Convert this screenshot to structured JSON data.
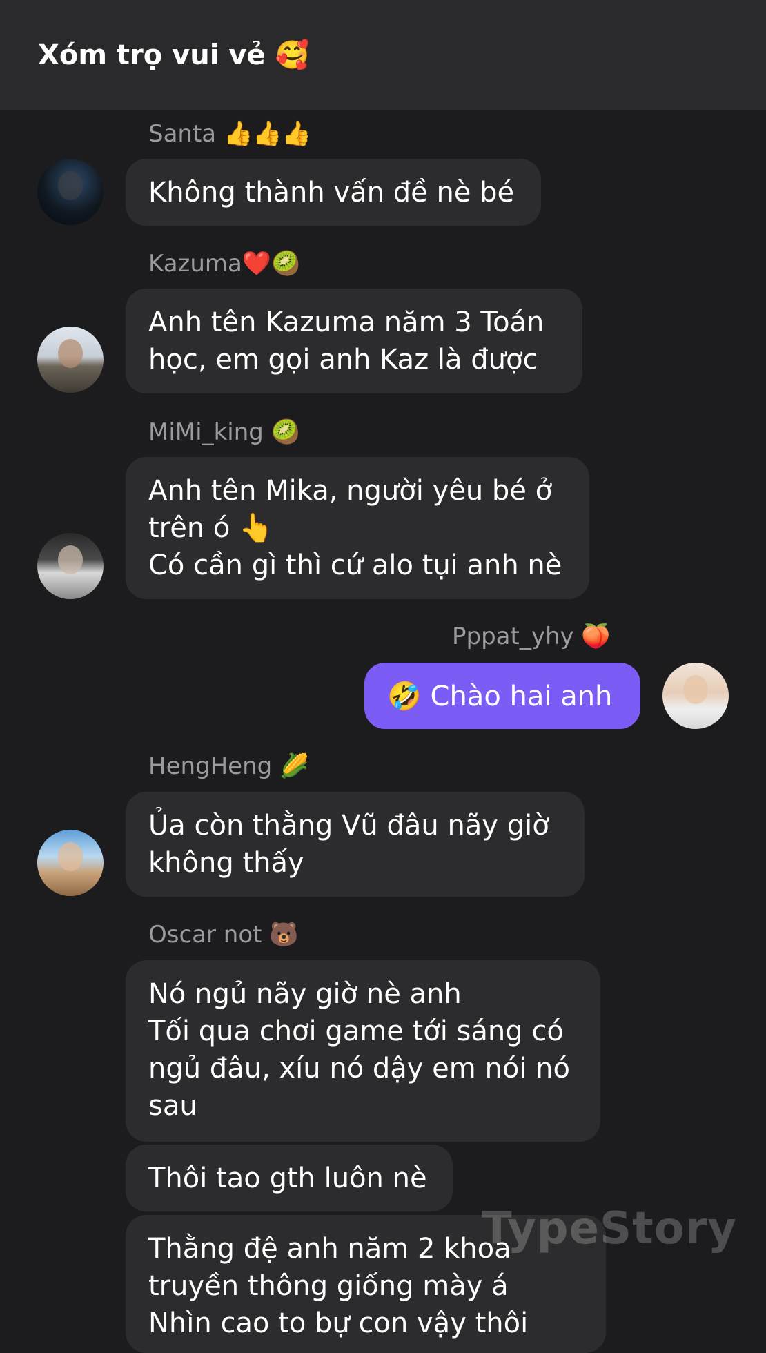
{
  "chat": {
    "title": "Xóm trọ vui vẻ 🥰"
  },
  "messages": [
    {
      "sender": "Santa 👍👍👍",
      "text": "Không thành vấn đề nè bé"
    },
    {
      "sender": "Kazuma❤️🥝",
      "text": "Anh tên Kazuma năm 3 Toán\nhọc, em gọi anh Kaz là được"
    },
    {
      "sender": "MiMi_king 🥝",
      "text": "Anh tên Mika, người yêu bé ở\ntrên ó 👆\nCó cần gì thì cứ alo tụi anh nè"
    },
    {
      "sender": "Pppat_yhy 🍑",
      "text": "🤣 Chào hai anh"
    },
    {
      "sender": "HengHeng 🌽",
      "text": "Ủa còn thằng Vũ đâu nãy giờ\nkhông thấy"
    },
    {
      "sender": "Oscar not 🐻",
      "text": "Nó ngủ nãy giờ nè anh\nTối qua chơi game tới sáng có\nngủ đâu, xíu nó dậy em nói nó\nsau"
    },
    {
      "sender": "",
      "text": "Thôi tao gth luôn nè"
    },
    {
      "sender": "",
      "text": "Thằng đệ anh năm 2 khoa\ntruyền thông giống mày á\nNhìn cao to bự con vậy thôi"
    }
  ],
  "watermark": "TypeStory",
  "colors": {
    "background": "#1c1c1e",
    "header": "#2a2a2c",
    "bubble_incoming": "#2c2c2e",
    "bubble_outgoing": "#7b5cf5",
    "sender_name": "#9a9a9f"
  }
}
